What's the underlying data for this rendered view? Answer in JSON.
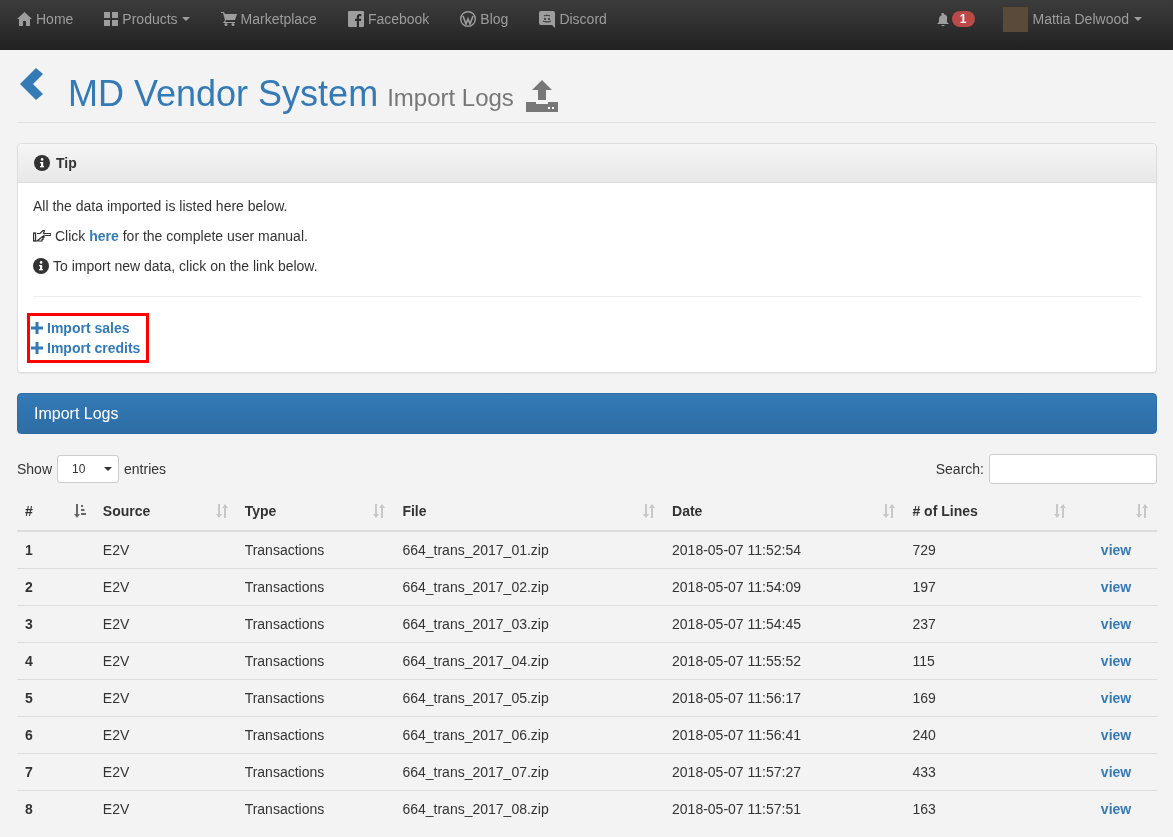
{
  "navbar": {
    "items": [
      {
        "label": "Home",
        "kind": "home",
        "dropdown": false
      },
      {
        "label": "Products",
        "kind": "grid",
        "dropdown": true
      },
      {
        "label": "Marketplace",
        "kind": "cart",
        "dropdown": false
      },
      {
        "label": "Facebook",
        "kind": "facebook",
        "dropdown": false
      },
      {
        "label": "Blog",
        "kind": "wordpress",
        "dropdown": false
      },
      {
        "label": "Discord",
        "kind": "discord",
        "dropdown": false
      }
    ],
    "notifications": "1",
    "user": {
      "name": "Mattia Delwood"
    }
  },
  "header": {
    "title": "MD Vendor System",
    "subtitle": "Import Logs"
  },
  "tip": {
    "title": "Tip",
    "lines": [
      {
        "kind": "plain",
        "text": "All the data imported is listed here below."
      },
      {
        "kind": "hand",
        "before": "Click ",
        "link": "here",
        "after": " for the complete user manual."
      },
      {
        "kind": "info",
        "text": "To import new data, click on the link below."
      }
    ],
    "links_highlighted": true,
    "links": [
      "Import sales",
      "Import credits"
    ]
  },
  "logs": {
    "title": "Import Logs",
    "length": {
      "label_before": "Show",
      "value": "10",
      "label_after": "entries"
    },
    "search": {
      "label": "Search:"
    },
    "columns": [
      {
        "label": "#",
        "sorted": true
      },
      {
        "label": "Source",
        "sorted": false
      },
      {
        "label": "Type",
        "sorted": false
      },
      {
        "label": "File",
        "sorted": false
      },
      {
        "label": "Date",
        "sorted": false
      },
      {
        "label": "# of Lines",
        "sorted": false
      },
      {
        "sorted": false
      }
    ],
    "rows": [
      {
        "id": "1",
        "source": "E2V",
        "type": "Transactions",
        "file": "664_trans_2017_01.zip",
        "date": "2018-05-07 11:52:54",
        "lines": "729",
        "action": "view"
      },
      {
        "id": "2",
        "source": "E2V",
        "type": "Transactions",
        "file": "664_trans_2017_02.zip",
        "date": "2018-05-07 11:54:09",
        "lines": "197",
        "action": "view"
      },
      {
        "id": "3",
        "source": "E2V",
        "type": "Transactions",
        "file": "664_trans_2017_03.zip",
        "date": "2018-05-07 11:54:45",
        "lines": "237",
        "action": "view"
      },
      {
        "id": "4",
        "source": "E2V",
        "type": "Transactions",
        "file": "664_trans_2017_04.zip",
        "date": "2018-05-07 11:55:52",
        "lines": "115",
        "action": "view"
      },
      {
        "id": "5",
        "source": "E2V",
        "type": "Transactions",
        "file": "664_trans_2017_05.zip",
        "date": "2018-05-07 11:56:17",
        "lines": "169",
        "action": "view"
      },
      {
        "id": "6",
        "source": "E2V",
        "type": "Transactions",
        "file": "664_trans_2017_06.zip",
        "date": "2018-05-07 11:56:41",
        "lines": "240",
        "action": "view"
      },
      {
        "id": "7",
        "source": "E2V",
        "type": "Transactions",
        "file": "664_trans_2017_07.zip",
        "date": "2018-05-07 11:57:27",
        "lines": "433",
        "action": "view"
      },
      {
        "id": "8",
        "source": "E2V",
        "type": "Transactions",
        "file": "664_trans_2017_08.zip",
        "date": "2018-05-07 11:57:51",
        "lines": "163",
        "action": "view"
      }
    ]
  }
}
